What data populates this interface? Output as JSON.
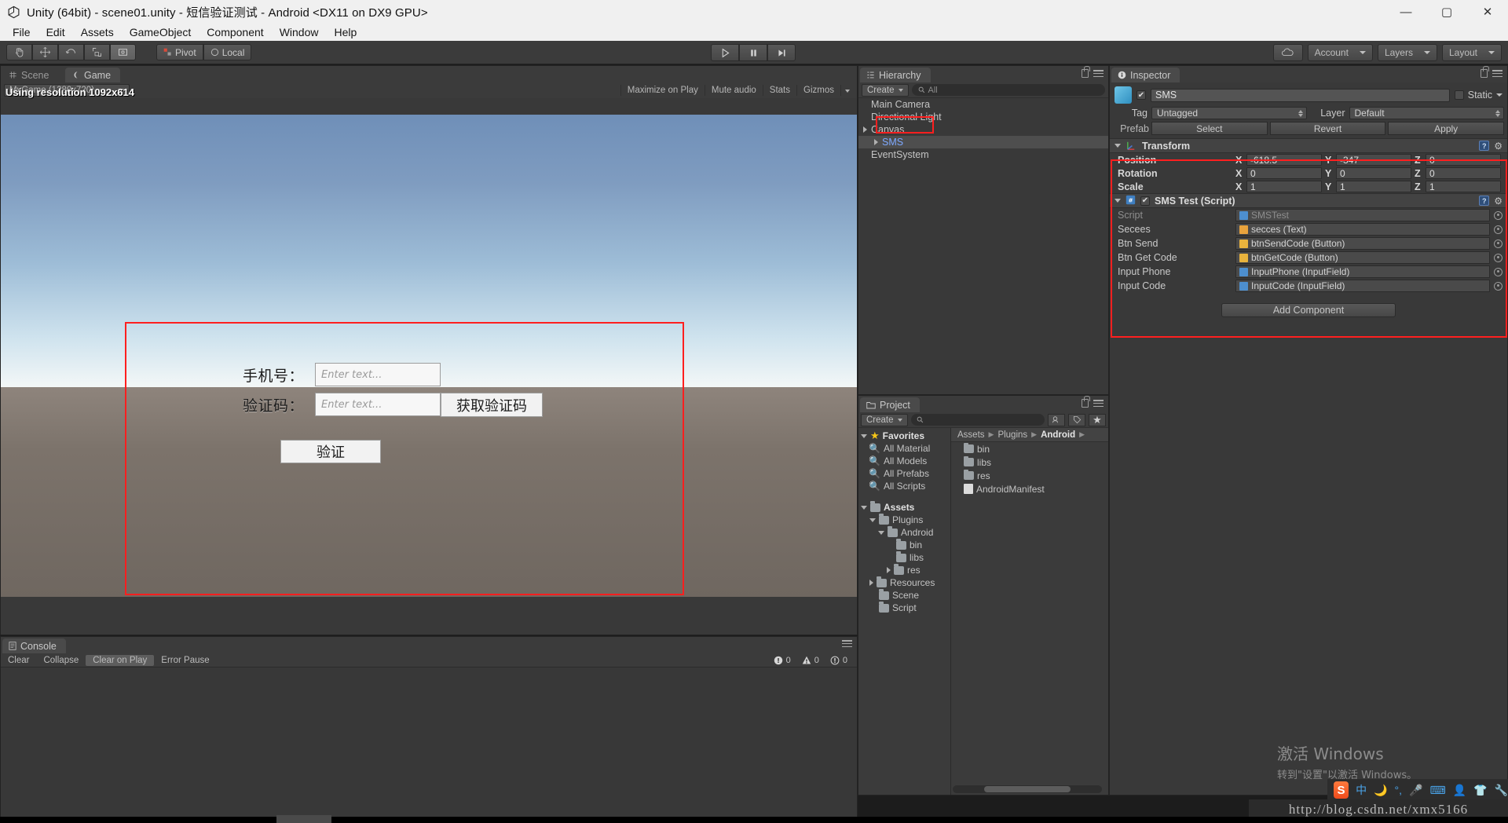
{
  "window": {
    "title": "Unity (64bit) - scene01.unity - 短信验证测试 - Android <DX11 on DX9 GPU>",
    "minimize": "—",
    "maximize": "▢",
    "close": "✕"
  },
  "menu": [
    "File",
    "Edit",
    "Assets",
    "GameObject",
    "Component",
    "Window",
    "Help"
  ],
  "toolbar": {
    "tools": [
      "hand-tool",
      "move-tool",
      "rotate-tool",
      "scale-tool",
      "rect-tool"
    ],
    "pivot_label": "Pivot",
    "local_label": "Local",
    "play_label": "play-icon",
    "pause_label": "pause-icon",
    "step_label": "step-icon",
    "cloud_label": "cloud-icon",
    "account_label": "Account",
    "layers_label": "Layers",
    "layout_label": "Layout"
  },
  "game_panel": {
    "tab_scene": "Scene",
    "tab_game": "Game",
    "resolution_dropdown": "MyGame (1280x720)",
    "maximize_on_play": "Maximize on Play",
    "mute_audio": "Mute audio",
    "stats": "Stats",
    "gizmos": "Gizmos",
    "using_resolution": "Using resolution 1092x614",
    "form": {
      "phone_label": "手机号：",
      "phone_placeholder": "Enter text...",
      "code_label": "验证码：",
      "code_placeholder": "Enter text...",
      "get_code_button": "获取验证码",
      "verify_button": "验证"
    }
  },
  "console": {
    "tab": "Console",
    "buttons": [
      "Clear",
      "Collapse",
      "Clear on Play",
      "Error Pause"
    ],
    "counts": {
      "errors": "0",
      "warnings": "0",
      "infos": "0"
    }
  },
  "hierarchy": {
    "tab": "Hierarchy",
    "create_label": "Create",
    "search_placeholder": "All",
    "items": [
      {
        "label": "Main Camera",
        "indent": 0,
        "expandable": false,
        "selected": false,
        "blue": false
      },
      {
        "label": "Directional Light",
        "indent": 0,
        "expandable": false,
        "selected": false,
        "blue": false
      },
      {
        "label": "Canvas",
        "indent": 0,
        "expandable": true,
        "selected": false,
        "blue": false
      },
      {
        "label": "SMS",
        "indent": 1,
        "expandable": true,
        "selected": true,
        "blue": true
      },
      {
        "label": "EventSystem",
        "indent": 0,
        "expandable": false,
        "selected": false,
        "blue": false
      }
    ]
  },
  "project": {
    "tab": "Project",
    "create_label": "Create",
    "search_placeholder": "",
    "favorites_label": "Favorites",
    "favorites": [
      "All Material",
      "All Models",
      "All Prefabs",
      "All Scripts"
    ],
    "assets_label": "Assets",
    "tree": [
      {
        "label": "Plugins",
        "indent": 1,
        "state": "open"
      },
      {
        "label": "Android",
        "indent": 2,
        "state": "open"
      },
      {
        "label": "bin",
        "indent": 3,
        "state": "leaf"
      },
      {
        "label": "libs",
        "indent": 3,
        "state": "leaf"
      },
      {
        "label": "res",
        "indent": 3,
        "state": "closed"
      },
      {
        "label": "Resources",
        "indent": 1,
        "state": "closed"
      },
      {
        "label": "Scene",
        "indent": 1,
        "state": "leaf"
      },
      {
        "label": "Script",
        "indent": 1,
        "state": "leaf"
      }
    ],
    "breadcrumb": [
      "Assets",
      "Plugins",
      "Android"
    ],
    "contents": [
      {
        "label": "bin",
        "type": "folder"
      },
      {
        "label": "libs",
        "type": "folder"
      },
      {
        "label": "res",
        "type": "folder"
      },
      {
        "label": "AndroidManifest",
        "type": "file"
      }
    ]
  },
  "inspector": {
    "tab": "Inspector",
    "object_name": "SMS",
    "static_label": "Static",
    "tag_label": "Tag",
    "tag_value": "Untagged",
    "layer_label": "Layer",
    "layer_value": "Default",
    "prefab_label": "Prefab",
    "prefab_buttons": [
      "Select",
      "Revert",
      "Apply"
    ],
    "transform": {
      "title": "Transform",
      "rows": [
        {
          "label": "Position",
          "x": "-618.5",
          "y": "-347",
          "z": "0"
        },
        {
          "label": "Rotation",
          "x": "0",
          "y": "0",
          "z": "0"
        },
        {
          "label": "Scale",
          "x": "1",
          "y": "1",
          "z": "1"
        }
      ],
      "axes": [
        "X",
        "Y",
        "Z"
      ]
    },
    "script_component": {
      "title": "SMS Test (Script)",
      "rows": [
        {
          "label": "Script",
          "value": "SMSTest",
          "icon": "cs-script-icon",
          "dim": true,
          "picker": true
        },
        {
          "label": "Secees",
          "value": "secces (Text)",
          "icon": "text-icon",
          "dim": false,
          "picker": true
        },
        {
          "label": "Btn Send",
          "value": "btnSendCode (Button)",
          "icon": "button-icon",
          "dim": false,
          "picker": true
        },
        {
          "label": "Btn Get Code",
          "value": "btnGetCode (Button)",
          "icon": "button-icon",
          "dim": false,
          "picker": true
        },
        {
          "label": "Input Phone",
          "value": "InputPhone (InputField)",
          "icon": "inputfield-icon",
          "dim": false,
          "picker": true
        },
        {
          "label": "Input Code",
          "value": "InputCode (InputField)",
          "icon": "inputfield-icon",
          "dim": false,
          "picker": true
        }
      ]
    },
    "add_component": "Add Component"
  },
  "watermark": {
    "line1": "激活 Windows",
    "line2": "转到\"设置\"以激活 Windows。"
  },
  "tray": {
    "ime_label": "中",
    "icons": [
      "sogou-icon",
      "ime-chinese-icon",
      "moon-icon",
      "degree-icon",
      "mic-icon",
      "keyboard-icon",
      "user-icon",
      "shirt-icon",
      "wrench-icon"
    ]
  },
  "csdn_url": "http://blog.csdn.net/xmx5166",
  "colors": {
    "accent_red": "#ff1f1f",
    "panel_bg": "#393939",
    "toolbar_bg": "#3b3b3b",
    "titlebar_bg": "#f0f0f0"
  }
}
